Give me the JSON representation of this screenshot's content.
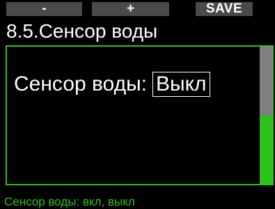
{
  "softkeys": {
    "minus_label": "-",
    "plus_label": "+",
    "save_label": "SAVE"
  },
  "header": {
    "title": "8.5.Сенсор воды"
  },
  "setting": {
    "label": "Сенсор воды:",
    "value": "Выкл"
  },
  "status": {
    "text": "Сенсор воды: вкл, выкл"
  },
  "colors": {
    "accent": "#2ec21d",
    "softkey_bg": "#4a4a4a",
    "scroll_thumb": "#7f7f7f",
    "background": "#000000",
    "text": "#ffffff"
  }
}
